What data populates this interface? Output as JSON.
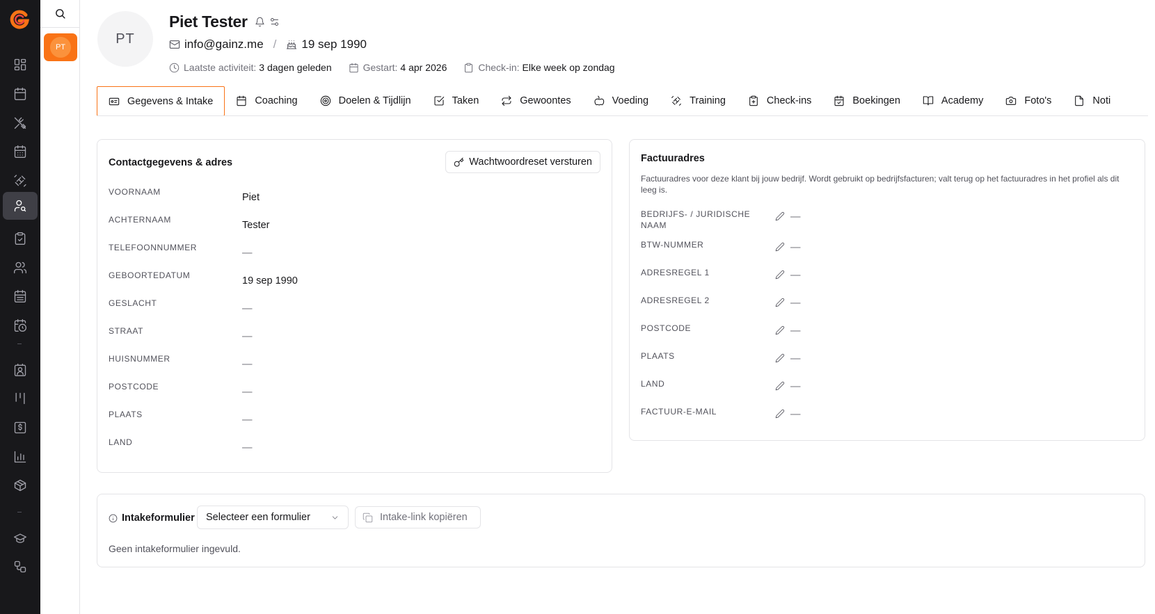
{
  "brand": {
    "accent": "#f97316",
    "rail_bg": "#18181b"
  },
  "sidebar": {
    "items": [
      {
        "icon": "dashboard-icon"
      },
      {
        "icon": "calendar-icon"
      },
      {
        "icon": "utensils-icon"
      },
      {
        "icon": "calendar-grid-icon"
      },
      {
        "icon": "dumbbell-icon"
      },
      {
        "icon": "user-search-icon",
        "active": true
      },
      {
        "icon": "clipboard-check-icon"
      },
      {
        "icon": "users-icon"
      },
      {
        "icon": "calendar-days-icon"
      },
      {
        "icon": "calendar-clock-icon"
      },
      {
        "icon": "contact-icon"
      },
      {
        "icon": "kanban-icon"
      },
      {
        "icon": "invoice-icon"
      },
      {
        "icon": "bar-chart-icon"
      },
      {
        "icon": "package-icon"
      },
      {
        "icon": "graduation-cap-icon"
      },
      {
        "icon": "workflow-icon"
      }
    ]
  },
  "client_list": {
    "active_initials": "PT"
  },
  "client": {
    "initials": "PT",
    "name": "Piet Tester",
    "email": "info@gainz.me",
    "birthdate": "19 sep 1990",
    "last_activity_label": "Laatste activiteit:",
    "last_activity_value": "3 dagen geleden",
    "started_label": "Gestart:",
    "started_value": "4 apr 2026",
    "checkin_label": "Check-in:",
    "checkin_value": "Elke week op zondag"
  },
  "tabs": [
    {
      "label": "Gegevens & Intake",
      "icon": "id-card-icon",
      "active": true
    },
    {
      "label": "Coaching",
      "icon": "calendar-icon"
    },
    {
      "label": "Doelen & Tijdlijn",
      "icon": "target-icon"
    },
    {
      "label": "Taken",
      "icon": "checkbox-icon"
    },
    {
      "label": "Gewoontes",
      "icon": "repeat-icon"
    },
    {
      "label": "Voeding",
      "icon": "apple-icon"
    },
    {
      "label": "Training",
      "icon": "dumbbell-icon"
    },
    {
      "label": "Check-ins",
      "icon": "clipboard-icon"
    },
    {
      "label": "Boekingen",
      "icon": "calendar-check-icon"
    },
    {
      "label": "Academy",
      "icon": "book-icon"
    },
    {
      "label": "Foto's",
      "icon": "camera-icon"
    },
    {
      "label": "Noti",
      "icon": "file-icon"
    }
  ],
  "contact_card": {
    "title": "Contactgegevens & adres",
    "reset_button": "Wachtwoordreset versturen",
    "fields": [
      {
        "label": "VOORNAAM",
        "value": "Piet"
      },
      {
        "label": "ACHTERNAAM",
        "value": "Tester"
      },
      {
        "label": "TELEFOONNUMMER",
        "value": "—"
      },
      {
        "label": "GEBOORTEDATUM",
        "value": "19 sep 1990"
      },
      {
        "label": "GESLACHT",
        "value": "—"
      },
      {
        "label": "STRAAT",
        "value": "—"
      },
      {
        "label": "HUISNUMMER",
        "value": "—"
      },
      {
        "label": "POSTCODE",
        "value": "—"
      },
      {
        "label": "PLAATS",
        "value": "—"
      },
      {
        "label": "LAND",
        "value": "—"
      }
    ]
  },
  "billing_card": {
    "title": "Factuuradres",
    "description": "Factuuradres voor deze klant bij jouw bedrijf. Wordt gebruikt op bedrijfsfacturen; valt terug op het factuuradres in het profiel als dit leeg is.",
    "fields": [
      {
        "label": "BEDRIJFS- / JURIDISCHE NAAM",
        "value": "—"
      },
      {
        "label": "BTW-NUMMER",
        "value": "—"
      },
      {
        "label": "ADRESREGEL 1",
        "value": "—"
      },
      {
        "label": "ADRESREGEL 2",
        "value": "—"
      },
      {
        "label": "POSTCODE",
        "value": "—"
      },
      {
        "label": "PLAATS",
        "value": "—"
      },
      {
        "label": "LAND",
        "value": "—"
      },
      {
        "label": "FACTUUR-E-MAIL",
        "value": "—"
      }
    ]
  },
  "intake": {
    "label": "Intakeformulier",
    "select_value": "Selecteer een formulier",
    "copy_button": "Intake-link kopiëren",
    "empty_text": "Geen intakeformulier ingevuld."
  }
}
